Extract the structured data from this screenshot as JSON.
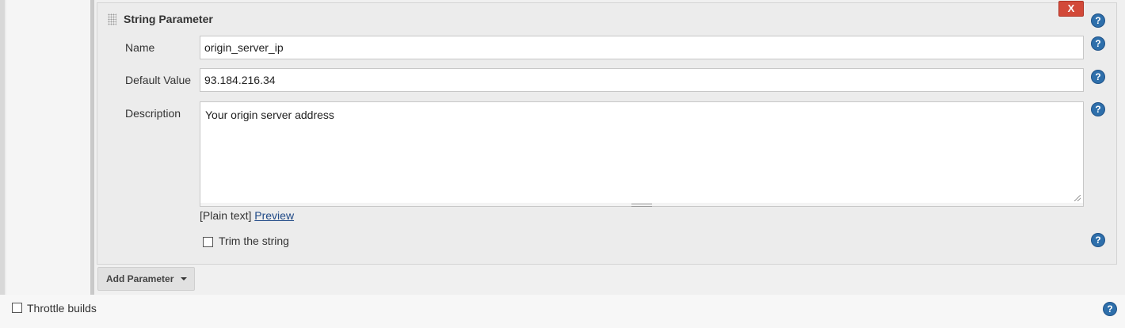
{
  "parameter": {
    "title": "String Parameter",
    "delete_label": "X",
    "name_label": "Name",
    "name_value": "origin_server_ip",
    "default_label": "Default Value",
    "default_value": "93.184.216.34",
    "description_label": "Description",
    "description_value": "Your origin server address",
    "format_plain": "[Plain text]",
    "format_preview": "Preview",
    "trim_label": "Trim the string",
    "trim_checked": false
  },
  "add_parameter_label": "Add Parameter",
  "throttle": {
    "label": "Throttle builds",
    "checked": false
  },
  "help_glyph": "?",
  "colors": {
    "delete": "#d24939",
    "help": "#2e6fab",
    "link": "#204a87"
  }
}
